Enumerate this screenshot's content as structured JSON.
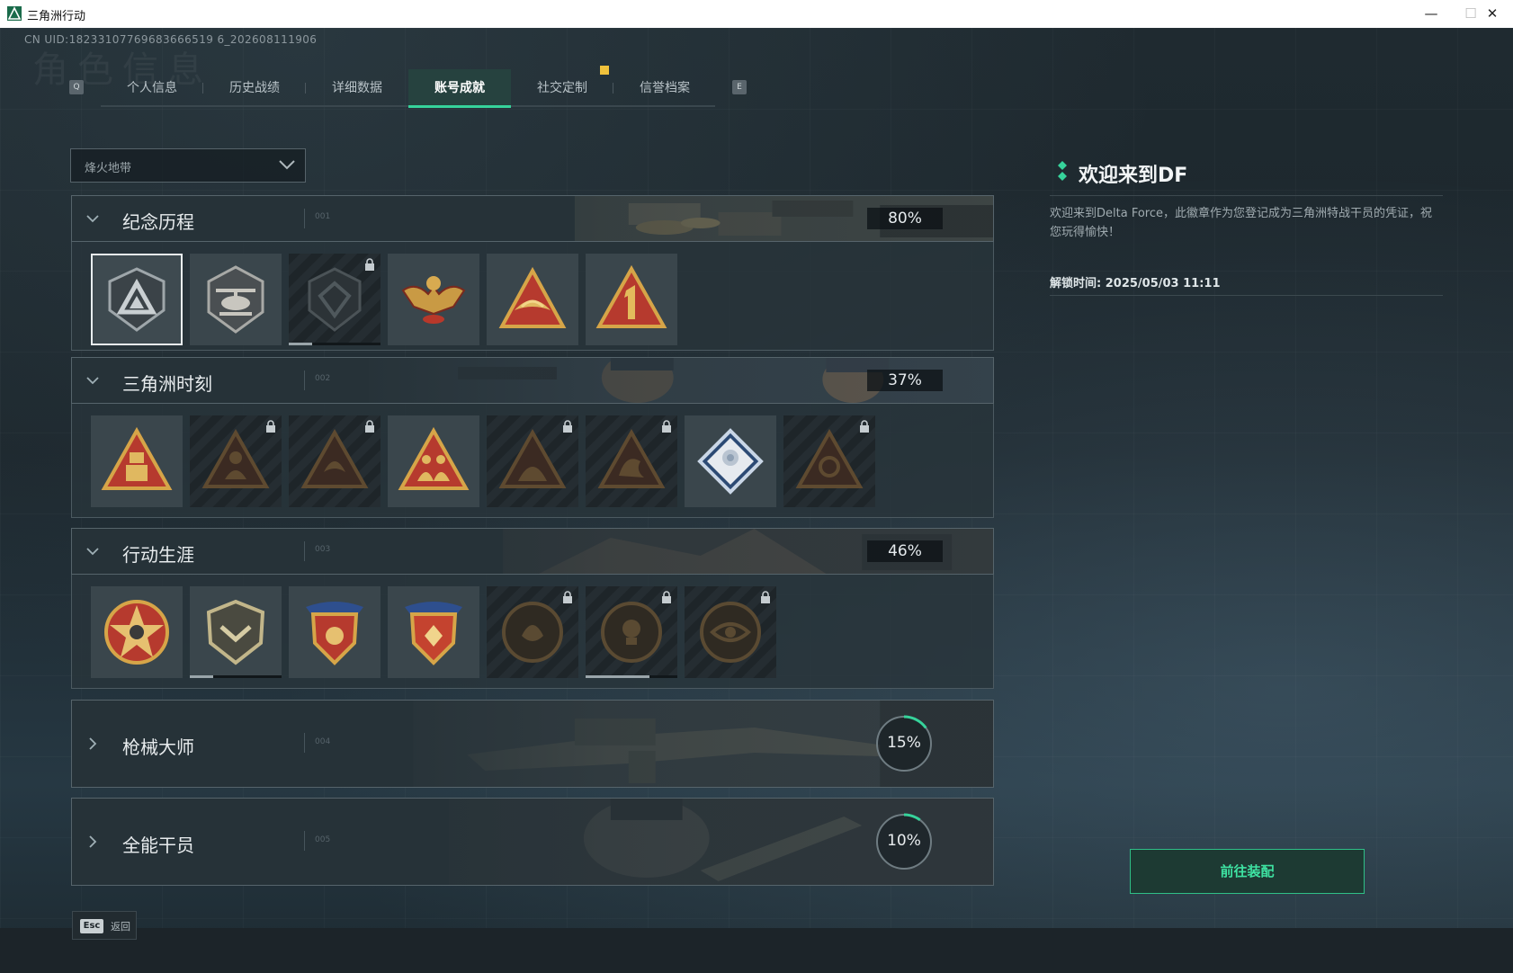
{
  "window": {
    "title": "三角洲行动",
    "minimize": "—",
    "maximize": "☐",
    "close": "✕"
  },
  "uid": "CN UID:18233107769683666519 6_202608111906",
  "ghost_title": "角色信息",
  "tabs": {
    "key_left": "Q",
    "key_right": "E",
    "items": [
      {
        "label": "个人信息",
        "active": false
      },
      {
        "label": "历史战绩",
        "active": false
      },
      {
        "label": "详细数据",
        "active": false
      },
      {
        "label": "账号成就",
        "active": true
      },
      {
        "label": "社交定制",
        "active": false,
        "notification": true
      },
      {
        "label": "信誉档案",
        "active": false
      }
    ]
  },
  "mode_select": {
    "value": "烽火地带"
  },
  "sections": [
    {
      "title": "纪念历程",
      "code": "001",
      "progress": "80%",
      "progress_value": 0.8,
      "expanded": true,
      "badges": [
        {
          "icon": "delta-triangle-shield-icon",
          "locked": false,
          "selected": true
        },
        {
          "icon": "helicopter-shield-icon",
          "locked": false
        },
        {
          "icon": "dark-shield-emblem-icon",
          "locked": true,
          "progress": 0.25
        },
        {
          "icon": "golden-eagle-wings-icon",
          "locked": false
        },
        {
          "icon": "triangle-wings-icon",
          "locked": false
        },
        {
          "icon": "triangle-number-one-icon",
          "locked": false
        }
      ]
    },
    {
      "title": "三角洲时刻",
      "code": "002",
      "progress": "37%",
      "progress_value": 0.37,
      "expanded": true,
      "badges": [
        {
          "icon": "triangle-robot-icon",
          "locked": false
        },
        {
          "icon": "triangle-operator-icon",
          "locked": true
        },
        {
          "icon": "triangle-swirl-icon",
          "locked": true
        },
        {
          "icon": "triangle-squad-icon",
          "locked": false
        },
        {
          "icon": "triangle-soldiers-icon",
          "locked": true
        },
        {
          "icon": "triangle-dragon-icon",
          "locked": true
        },
        {
          "icon": "diamond-flower-icon",
          "locked": false
        },
        {
          "icon": "triangle-skull-icon",
          "locked": true
        }
      ]
    },
    {
      "title": "行动生涯",
      "code": "003",
      "progress": "46%",
      "progress_value": 0.46,
      "expanded": true,
      "badges": [
        {
          "icon": "star-skull-medal-icon",
          "locked": false
        },
        {
          "icon": "shield-chevron-medal-icon",
          "locked": false,
          "progress": 0.25
        },
        {
          "icon": "blue-star-shield-medal-icon",
          "locked": false
        },
        {
          "icon": "red-star-shield-medal-icon",
          "locked": false
        },
        {
          "icon": "round-swirl-medal-icon",
          "locked": true
        },
        {
          "icon": "round-skull-medal-icon",
          "locked": true,
          "progress": 0.7
        },
        {
          "icon": "round-eye-medal-icon",
          "locked": true
        }
      ]
    },
    {
      "title": "枪械大师",
      "code": "004",
      "progress": "15%",
      "progress_value": 0.15,
      "expanded": false,
      "ring": true
    },
    {
      "title": "全能干员",
      "code": "005",
      "progress": "10%",
      "progress_value": 0.1,
      "expanded": false,
      "ring": true
    }
  ],
  "detail": {
    "title": "欢迎来到DF",
    "description": "欢迎来到Delta Force，此徽章作为您登记成为三角洲特战干员的凭证，祝您玩得愉快！",
    "unlock_time": "解锁时间: 2025/05/03 11:11",
    "equip_button": "前往装配"
  },
  "footer": {
    "esc_key": "Esc",
    "back_label": "返回"
  },
  "colors": {
    "accent": "#36d39b",
    "gold": "#d6a548",
    "badge_red": "#b63a2e"
  }
}
